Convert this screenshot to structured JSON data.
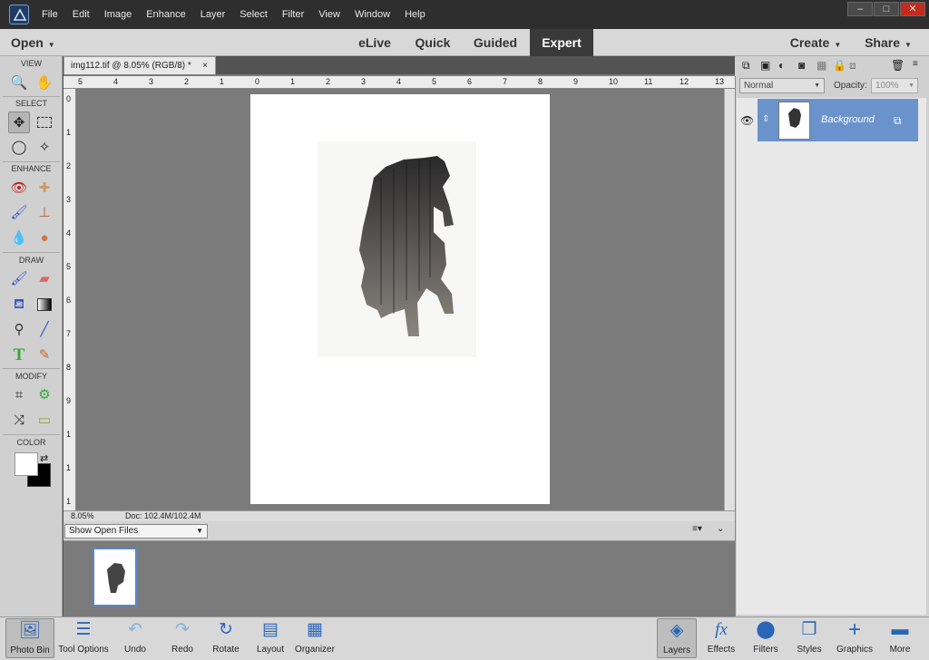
{
  "menu": [
    "File",
    "Edit",
    "Image",
    "Enhance",
    "Layer",
    "Select",
    "Filter",
    "View",
    "Window",
    "Help"
  ],
  "window_buttons": {
    "minimize": "–",
    "maximize": "□",
    "close": "✕"
  },
  "modebar": {
    "open_label": "Open",
    "modes": [
      "eLive",
      "Quick",
      "Guided",
      "Expert"
    ],
    "active_mode": "Expert",
    "create_label": "Create",
    "share_label": "Share"
  },
  "toolbox": {
    "sections": [
      "VIEW",
      "SELECT",
      "ENHANCE",
      "DRAW",
      "MODIFY",
      "COLOR"
    ],
    "tools": {
      "view": [
        "zoom-icon",
        "hand-icon"
      ],
      "select": [
        "move-icon",
        "marquee-icon",
        "lasso-icon",
        "magic-wand-icon"
      ],
      "enhance": [
        "red-eye-icon",
        "spot-healing-icon",
        "smart-brush-icon",
        "clone-stamp-icon",
        "blur-icon",
        "sponge-icon"
      ],
      "draw": [
        "brush-icon",
        "eraser-icon",
        "paint-bucket-icon",
        "gradient-icon",
        "eyedropper-icon",
        "line-icon",
        "type-icon",
        "pencil-icon"
      ],
      "modify": [
        "crop-icon",
        "recompose-icon",
        "content-aware-move-icon",
        "straighten-icon"
      ]
    },
    "colors": {
      "foreground": "#ffffff",
      "background": "#000000"
    }
  },
  "document": {
    "tab_title": "img112.tif @ 8.05% (RGB/8) *",
    "ruler_h": [
      "5",
      "4",
      "3",
      "2",
      "1",
      "0",
      "1",
      "2",
      "3",
      "4",
      "5",
      "6",
      "7",
      "8",
      "9",
      "10",
      "11",
      "12",
      "13"
    ],
    "ruler_v": [
      "0",
      "1",
      "2",
      "3",
      "4",
      "5",
      "6",
      "7",
      "8",
      "9",
      "1",
      "1",
      "1"
    ],
    "zoom": "8.05%",
    "doc_size": "Doc: 102.4M/102.4M"
  },
  "project_bin": {
    "selected": "Show Open Files"
  },
  "layers_panel": {
    "blend_mode": "Normal",
    "opacity_label": "Opacity:",
    "opacity_value": "100%",
    "layer_name": "Background"
  },
  "bottom_left": [
    {
      "label": "Photo Bin",
      "icon": "photo-bin-icon"
    },
    {
      "label": "Tool Options",
      "icon": "tool-options-icon"
    },
    {
      "label": "Undo",
      "icon": "undo-icon"
    },
    {
      "label": "Redo",
      "icon": "redo-icon"
    },
    {
      "label": "Rotate",
      "icon": "rotate-icon"
    },
    {
      "label": "Layout",
      "icon": "layout-icon"
    },
    {
      "label": "Organizer",
      "icon": "organizer-icon"
    }
  ],
  "bottom_right": [
    {
      "label": "Layers",
      "icon": "layers-icon"
    },
    {
      "label": "Effects",
      "icon": "effects-icon"
    },
    {
      "label": "Filters",
      "icon": "filters-icon"
    },
    {
      "label": "Styles",
      "icon": "styles-icon"
    },
    {
      "label": "Graphics",
      "icon": "graphics-icon"
    },
    {
      "label": "More",
      "icon": "more-icon"
    }
  ],
  "colors": {
    "accent": "#6a93cc",
    "active_mode_bg": "#3a3a3a",
    "canvas_bg": "#7b7b7b"
  }
}
